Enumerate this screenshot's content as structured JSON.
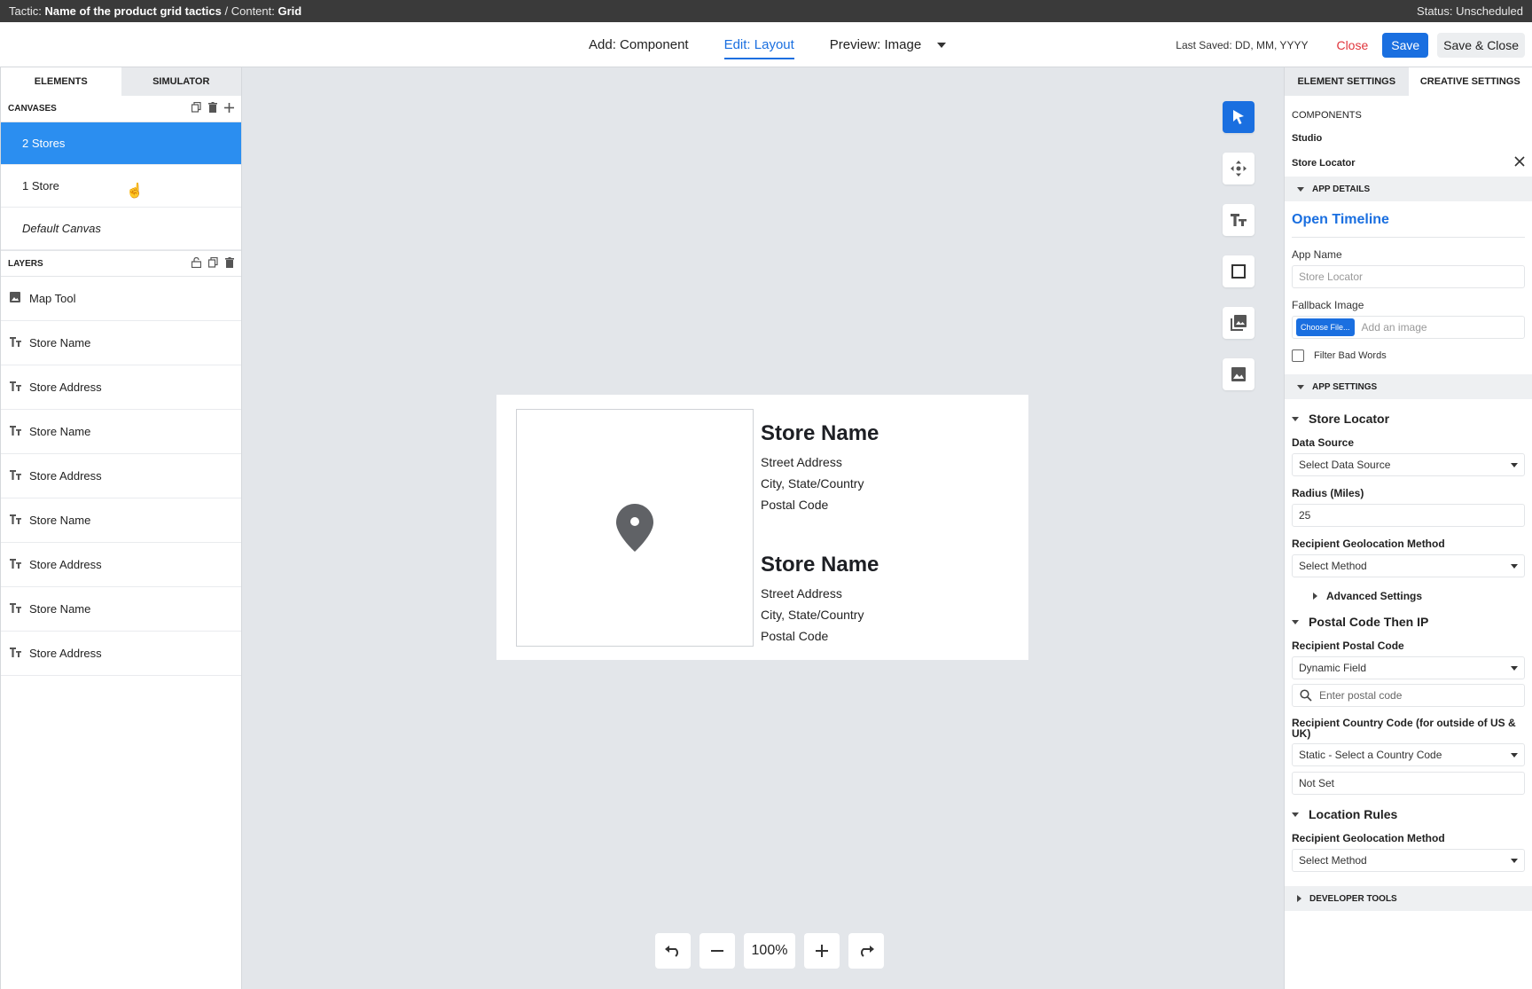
{
  "topbar": {
    "tactic_label": "Tactic:",
    "tactic_value": "Name of the product grid tactics",
    "separator": "/",
    "content_label": "Content:",
    "content_value": "Grid",
    "status": "Status: Unscheduled"
  },
  "header": {
    "modes": [
      "Add: Component",
      "Edit: Layout",
      "Preview: Image"
    ],
    "active_mode": "Edit: Layout",
    "last_saved": "Last Saved: DD, MM, YYYY",
    "close_label": "Close",
    "save_label": "Save",
    "save_close_label": "Save & Close"
  },
  "left_panel": {
    "tabs": [
      "ELEMENTS",
      "SIMULATOR"
    ],
    "canvases_title": "CANVASES",
    "canvases": [
      "2 Stores",
      "1 Store",
      "Default Canvas"
    ],
    "selected_canvas": "2 Stores",
    "layers_title": "LAYERS",
    "layers": [
      {
        "label": "Map Tool",
        "icon": "image-icon"
      },
      {
        "label": "Store Name",
        "icon": "text-icon"
      },
      {
        "label": "Store Address",
        "icon": "text-icon"
      },
      {
        "label": "Store Name",
        "icon": "text-icon"
      },
      {
        "label": "Store Address",
        "icon": "text-icon"
      },
      {
        "label": "Store Name",
        "icon": "text-icon"
      },
      {
        "label": "Store Address",
        "icon": "text-icon"
      },
      {
        "label": "Store Name",
        "icon": "text-icon"
      },
      {
        "label": "Store Address",
        "icon": "text-icon"
      }
    ]
  },
  "canvas": {
    "stores": [
      {
        "name": "Store Name",
        "street": "Street Address",
        "city": "City, State/Country",
        "postal": "Postal Code"
      },
      {
        "name": "Store Name",
        "street": "Street Address",
        "city": "City, State/Country",
        "postal": "Postal Code"
      }
    ],
    "tools": [
      "select-tool-icon",
      "move-tool-icon",
      "text-tool-icon",
      "shape-tool-icon",
      "gallery-tool-icon",
      "image-tool-icon"
    ],
    "zoom": "100%"
  },
  "right_panel": {
    "tabs": [
      "ELEMENT SETTINGS",
      "CREATIVE SETTINGS"
    ],
    "components_title": "COMPONENTS",
    "studio_label": "Studio",
    "component_name": "Store Locator",
    "app_details": {
      "title": "APP DETAILS",
      "open_timeline": "Open Timeline",
      "app_name_label": "App Name",
      "app_name_placeholder": "Store Locator",
      "fallback_label": "Fallback Image",
      "choose_file": "Choose File...",
      "fallback_placeholder": "Add an image",
      "filter_bad_words": "Filter Bad Words"
    },
    "app_settings": {
      "title": "APP SETTINGS",
      "store_locator_title": "Store Locator",
      "data_source_label": "Data Source",
      "data_source_value": "Select Data Source",
      "radius_label": "Radius (Miles)",
      "radius_value": "25",
      "geo_method_label": "Recipient Geolocation Method",
      "geo_method_value": "Select Method",
      "advanced_settings": "Advanced Settings",
      "postal_title": "Postal Code Then IP",
      "postal_label": "Recipient Postal Code",
      "postal_value": "Dynamic Field",
      "postal_search_placeholder": "Enter postal code",
      "country_label": "Recipient Country Code (for outside of US & UK)",
      "country_value": "Static - Select a Country Code",
      "not_set": "Not Set",
      "location_rules_title": "Location Rules",
      "location_geo_label": "Recipient Geolocation Method",
      "location_geo_value": "Select Method"
    },
    "developer_tools": "DEVELOPER TOOLS"
  }
}
